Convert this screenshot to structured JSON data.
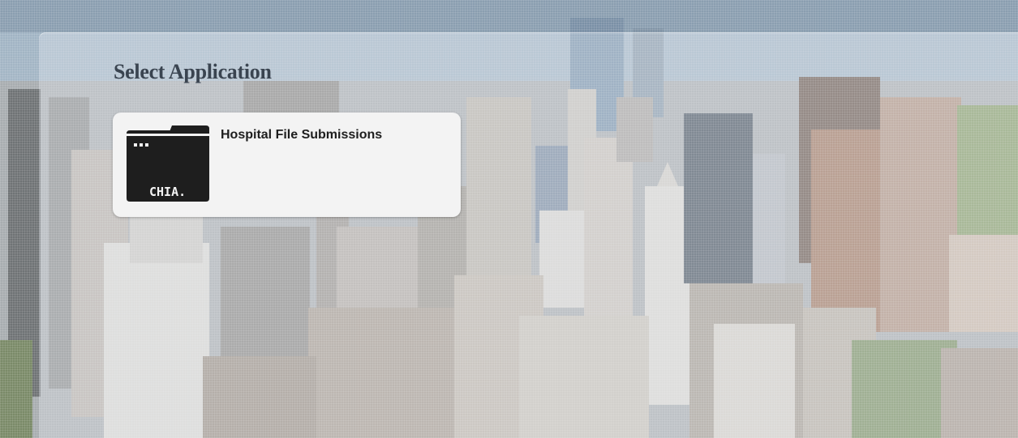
{
  "page": {
    "title": "Select Application"
  },
  "applications": [
    {
      "label": "Hospital File Submissions",
      "icon": "folder-icon",
      "icon_text": "CHIA."
    }
  ],
  "colors": {
    "title": "#3a4450",
    "tile_background": "#f3f3f3",
    "icon_fill": "#1e1e1e"
  }
}
